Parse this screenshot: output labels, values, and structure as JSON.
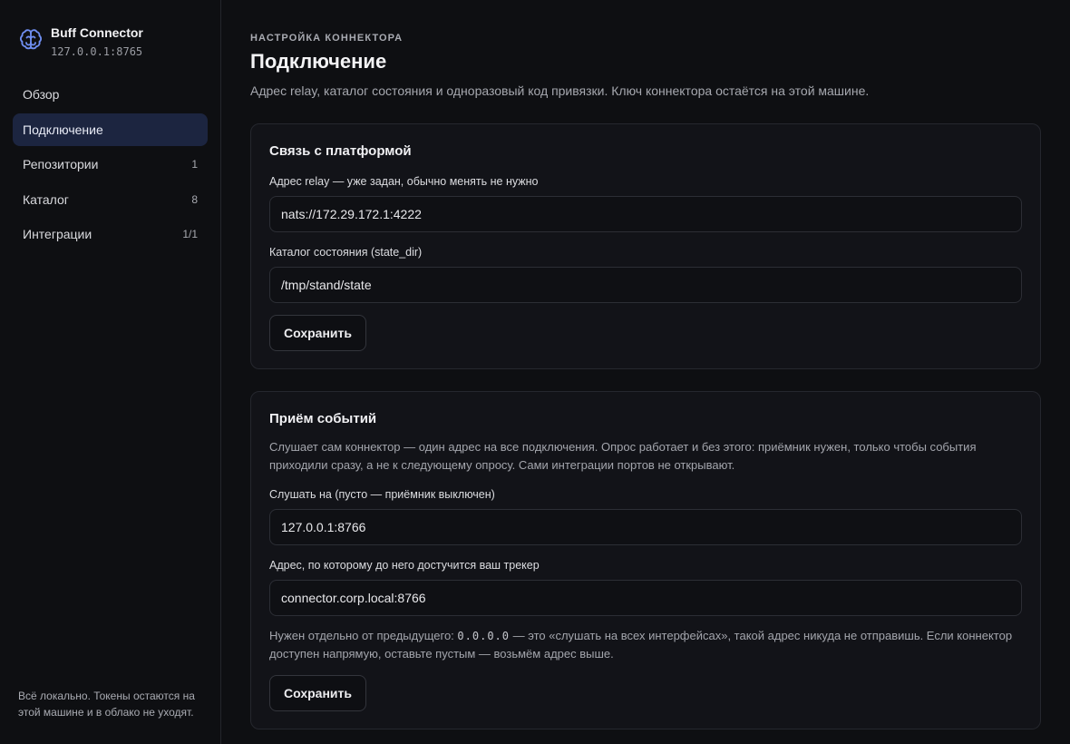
{
  "brand": {
    "title": "Buff Connector",
    "address": "127.0.0.1:8765"
  },
  "nav": [
    {
      "label": "Обзор",
      "count": "",
      "active": false
    },
    {
      "label": "Подключение",
      "count": "",
      "active": true
    },
    {
      "label": "Репозитории",
      "count": "1",
      "active": false
    },
    {
      "label": "Каталог",
      "count": "8",
      "active": false
    },
    {
      "label": "Интеграции",
      "count": "1/1",
      "active": false
    }
  ],
  "sidebar_footer": "Всё локально. Токены остаются на этой машине и в облако не уходят.",
  "header": {
    "eyebrow": "НАСТРОЙКА КОННЕКТОРА",
    "title": "Подключение",
    "description": "Адрес relay, каталог состояния и одноразовый код привязки. Ключ коннектора остаётся на этой машине."
  },
  "platform_card": {
    "title": "Связь с платформой",
    "relay_label": "Адрес relay — уже задан, обычно менять не нужно",
    "relay_value": "nats://172.29.172.1:4222",
    "state_label": "Каталог состояния (state_dir)",
    "state_value": "/tmp/stand/state",
    "save_label": "Сохранить"
  },
  "events_card": {
    "title": "Приём событий",
    "description": "Слушает сам коннектор — один адрес на все подключения. Опрос работает и без этого: приёмник нужен, только чтобы события приходили сразу, а не к следующему опросу. Сами интеграции портов не открывают.",
    "listen_label": "Слушать на (пусто — приёмник выключен)",
    "listen_value": "127.0.0.1:8766",
    "public_label": "Адрес, по которому до него достучится ваш трекер",
    "public_value": "connector.corp.local:8766",
    "hint_before": "Нужен отдельно от предыдущего: ",
    "hint_code": "0.0.0.0",
    "hint_after": " — это «слушать на всех интерфейсах», такой адрес никуда не отправишь. Если коннектор доступен напрямую, оставьте пустым — возьмём адрес выше.",
    "save_label": "Сохранить"
  },
  "colors": {
    "background": "#0e0f12",
    "card": "#121318",
    "active_nav": "#1c2540",
    "brand_icon": "#6f8ef0"
  }
}
